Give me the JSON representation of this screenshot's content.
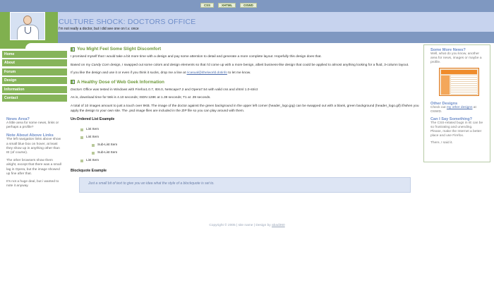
{
  "topbar": {
    "badges": [
      "CSS",
      "XHTML",
      "OSWD"
    ]
  },
  "header": {
    "title": "CULTURE SHOCK: DOCTORS OFFICE",
    "tagline": "I'm not really a doctor, but i did see one on t.v. once"
  },
  "nav": {
    "items": [
      "Home",
      "About",
      "Forum",
      "Design",
      "Information",
      "Contact"
    ]
  },
  "left": {
    "news_title": "News Area?",
    "news_text": "A little area for some news, links or perhaps a profile?",
    "note_title": "Note About Above Links",
    "note_text1": "The left navigation links above show a small blue box on hover, at least they show up in anything other than IE (of course).",
    "note_text2": "The other browsers show them alright, except that there was a small lag in Opera, but the image showed up fine after that.",
    "note_text3": "It's not a huge deal, but i wanted to note it anyway."
  },
  "main": {
    "h1": "You Might Feel Some Slight Discomfort",
    "p1": "I promised myself that I would take a bit more time with a design and pay some attention to detail and generate a more complete layout. Hopefully this design does that.",
    "p2_before": "Based on my ",
    "p2_em": "Candy Corn",
    "p2_after": " design, I swapped out some colors and design elements so that I'd come up with a more benign, albeit business-like design that could be applied to almost anything looking for a fluid, 3-column layout.",
    "p3_before": "If you like the design and use it or even if you think it sucks, drop me a line at ",
    "p3_link": "ricasual@ithelworld.dotinfo",
    "p3_after": " to let me know.",
    "h2": "A Healthy Dose of Web Geek Information",
    "p4_em": "Doctors",
    "p4_after": " Office was tested in Windows with Firefox1.0.7, IE6.0, Netscape7.2 and Opera7.54 with valid css and xhtml 1.0-strict",
    "p5": "As is, download time for 56k is 4.10 seconds; ISDN 128K at 1.39 seconds; T1 at .39 seconds.",
    "p6": "A total of 10 images amount to just a touch over 9KB. The image of the doctor against the green background in the upper left corner (header_logo.jpg) can be swapped out with a blank, green background (header_logo.gif) if/when you apply the design to your own site. The .psd image files are included in the ZIP file so you can play around with them.",
    "ul_title": "Un-Ordered List Example",
    "list": [
      "List Item",
      "List Item",
      "Sub-List Item",
      "Sub-List Item",
      "List Item"
    ],
    "bq_title": "Blockquote Example",
    "blockquote": "Just a small bit of text to give you an idea what the style of a blockquote is set to."
  },
  "right": {
    "news_title": "Some More News?",
    "news_text": "Well, what do you know, another area for news, images or maybe a profile.",
    "other_title": "Other Designs",
    "other_before": "Check out ",
    "other_link": "my other designs",
    "other_after": " at OSWD.",
    "say_title": "Can I Say Something?",
    "say_text": "The CSS-related bugs in IE can be so frustrating and unending. Please, make the Internet a better place and use Firefox.",
    "said": "There, I said it."
  },
  "footer": {
    "text": "Copyright © 2005 | site name |   Design by ",
    "credit": "abad360"
  },
  "colors": {
    "green": "#86b45a",
    "blue": "#7f98c1",
    "lightblue": "#c7d3ee",
    "title": "#6f8ec9"
  }
}
